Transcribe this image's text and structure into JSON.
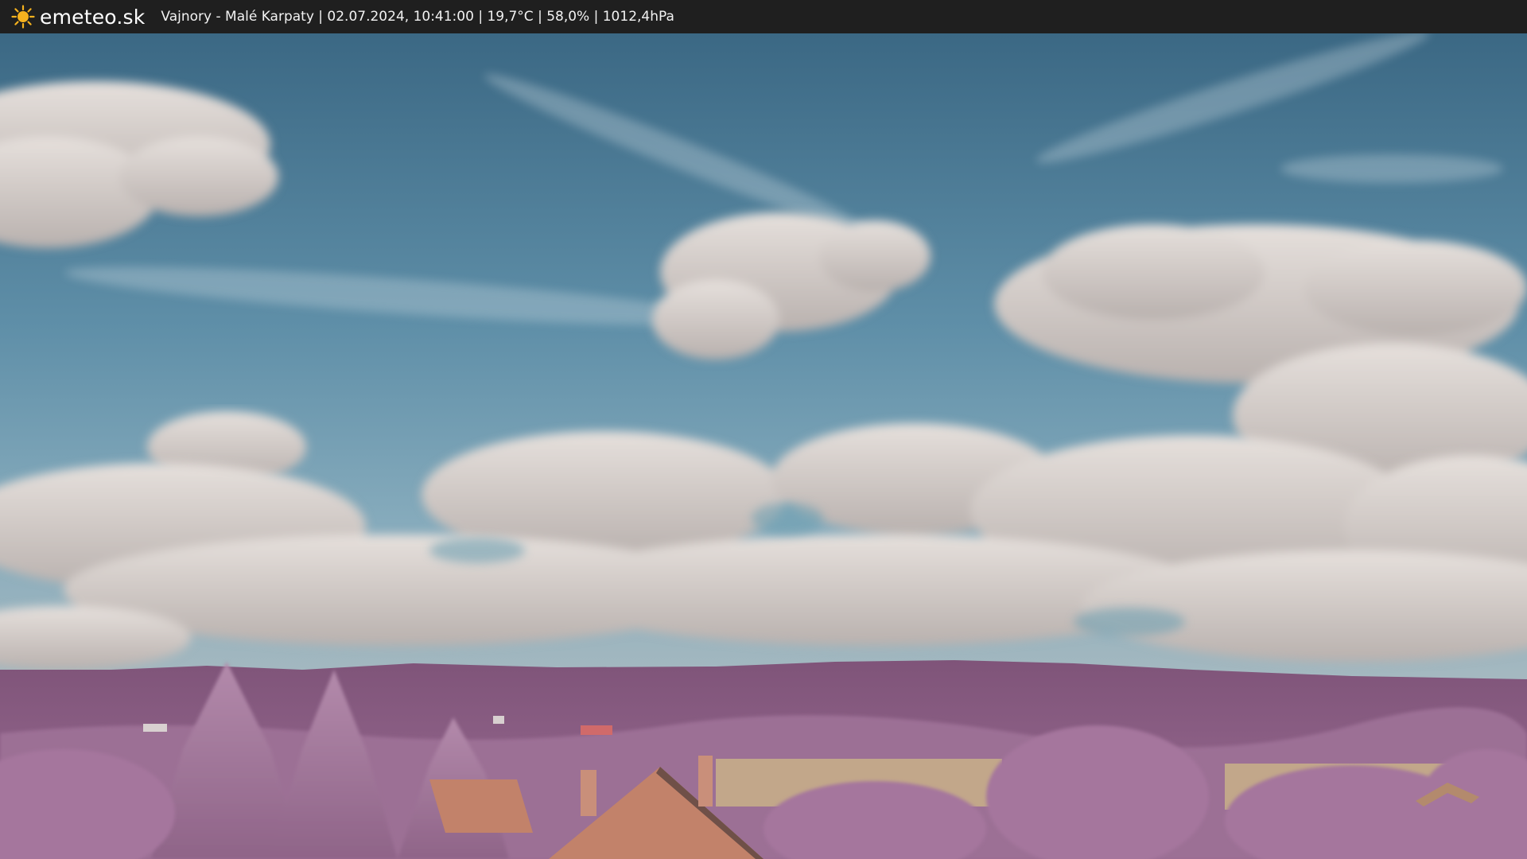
{
  "header": {
    "brand": "emeteo.sk",
    "logo_icon": "sun-icon",
    "caption": "Vajnory - Malé Karpaty | 02.07.2024, 10:41:00 | 19,7°C | 58,0% | 1012,4hPa"
  },
  "scene": {
    "description_icon": "webcam-photo",
    "colors": {
      "sky_top": "#3d6a86",
      "sky_bottom": "#7fa7ba",
      "cloud": "#d9d2cf",
      "hills": "#8c5f86",
      "foliage": "#a8799f",
      "roof": "#c2826a",
      "field": "#c7ad88",
      "bar": "#1f1f1f",
      "sun": "#f6b21e"
    }
  }
}
